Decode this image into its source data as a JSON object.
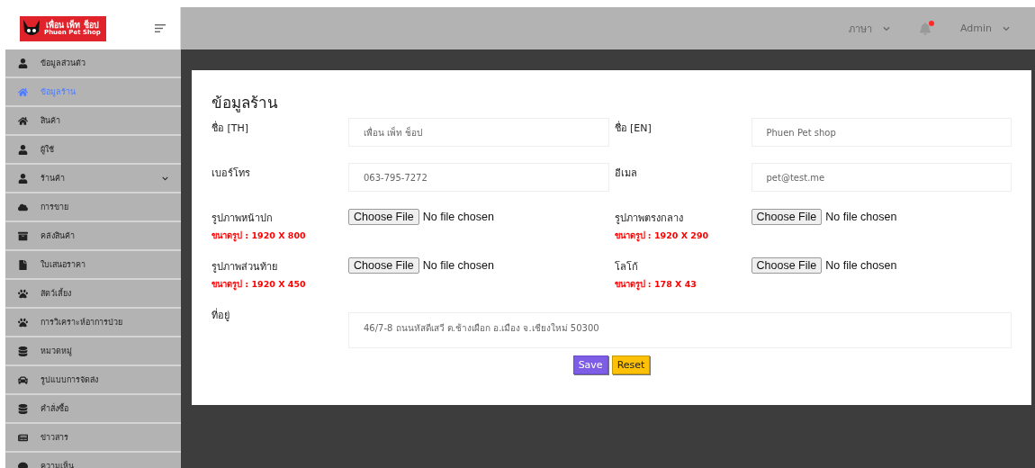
{
  "logo": {
    "title": "เพื่อน เพ็ท ช็อป",
    "subtitle": "Phuen Pet Shop"
  },
  "header": {
    "language": "ภาษา",
    "notification_dot": true,
    "user": "Admin"
  },
  "sidebar": {
    "items": [
      {
        "kind": "user",
        "label": "ข้อมูลส่วนตัว",
        "selected": false,
        "expandable": false
      },
      {
        "kind": "home",
        "label": "ข้อมูลร้าน",
        "selected": true,
        "expandable": false
      },
      {
        "kind": "home",
        "label": "สินค้า",
        "selected": false,
        "expandable": false
      },
      {
        "kind": "user",
        "label": "ผู้ใช้",
        "selected": false,
        "expandable": false
      },
      {
        "kind": "user",
        "label": "ร้านค้า",
        "selected": false,
        "expandable": true
      },
      {
        "kind": "cloud",
        "label": "การขาย",
        "selected": false,
        "expandable": false
      },
      {
        "kind": "archive",
        "label": "คลังสินค้า",
        "selected": false,
        "expandable": false
      },
      {
        "kind": "file",
        "label": "ใบเสนอราคา",
        "selected": false,
        "expandable": false
      },
      {
        "kind": "paw",
        "label": "สัตว์เลี้ยง",
        "selected": false,
        "expandable": false
      },
      {
        "kind": "paw",
        "label": "การวิเคราะห์อาการป่วย",
        "selected": false,
        "expandable": false
      },
      {
        "kind": "database",
        "label": "หมวดหมู่",
        "selected": false,
        "expandable": false
      },
      {
        "kind": "car",
        "label": "รูปแบบการจัดส่ง",
        "selected": false,
        "expandable": false
      },
      {
        "kind": "database",
        "label": "คำสั่งซื้อ",
        "selected": false,
        "expandable": false
      },
      {
        "kind": "news",
        "label": "ข่าวสาร",
        "selected": false,
        "expandable": false
      },
      {
        "kind": "comment",
        "label": "ความเห็น",
        "selected": false,
        "expandable": false
      }
    ]
  },
  "form": {
    "title": "ข้อมูลร้าน",
    "fields": [
      {
        "kind": "text",
        "label": "ชื่อ [TH]",
        "value": "เพื่อน เพ็ท ช็อป"
      },
      {
        "kind": "text",
        "label": "ชื่อ [EN]",
        "value": "Phuen Pet shop"
      },
      {
        "kind": "text",
        "label": "เบอร์โทร",
        "value": "063-795-7272"
      },
      {
        "kind": "text",
        "label": "อีเมล",
        "value": "pet@test.me"
      },
      {
        "kind": "file",
        "label": "รูปภาพหน้าปก",
        "hint": "ขนาดรูป : 1920 X 800",
        "button": "Choose File",
        "status": "No file chosen"
      },
      {
        "kind": "file",
        "label": "รูปภาพตรงกลาง",
        "hint": "ขนาดรูป : 1920 X 290",
        "button": "Choose File",
        "status": "No file chosen"
      },
      {
        "kind": "file",
        "label": "รูปภาพส่วนท้าย",
        "hint": "ขนาดรูป : 1920 X 450",
        "button": "Choose File",
        "status": "No file chosen"
      },
      {
        "kind": "file",
        "label": "โลโก้",
        "hint": "ขนาดรูป : 178 X 43",
        "button": "Choose File",
        "status": "No file chosen"
      },
      {
        "kind": "wide",
        "label": "ที่อยู่",
        "value": "46/7-8 ถนนหัสดีเสวี ต.ช้างเผือก อ.เมือง จ.เชียงใหม่ 50300"
      }
    ],
    "buttons": [
      {
        "kind": "primary",
        "label": "Save"
      },
      {
        "kind": "warning",
        "label": "Reset"
      }
    ]
  }
}
